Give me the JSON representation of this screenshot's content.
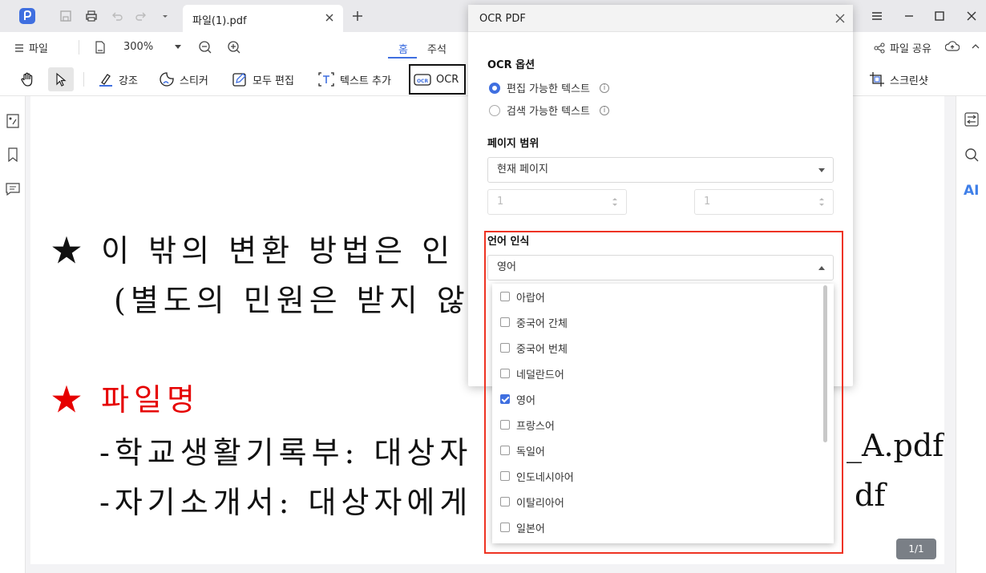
{
  "tab": {
    "title": "파일(1).pdf"
  },
  "menu": {
    "file": "파일",
    "zoom": "300%",
    "home": "홈",
    "annotate": "주석",
    "share": "파일 공유"
  },
  "toolbar": {
    "highlight": "강조",
    "sticker": "스티커",
    "edit_all": "모두 편집",
    "add_text": "텍스트 추가",
    "ocr": "OCR",
    "screenshot": "스크린샷"
  },
  "right_panel": {
    "ai": "AI"
  },
  "document": {
    "line1": "★ 이 밖의 변환 방법은 인",
    "line2": "(별도의 민원은 받지 않",
    "line3": "★ 파일명",
    "line4": "-학교생활기록부: 대상자",
    "line4_tail": "_A.pdf",
    "line5": "-자기소개서: 대상자에게",
    "line5_tail": "df",
    "page_indicator": "1/1"
  },
  "dialog": {
    "title": "OCR PDF",
    "ocr_options_label": "OCR 옵션",
    "radio_editable": "편집 가능한 텍스트",
    "radio_searchable": "검색 가능한 텍스트",
    "page_range_label": "페이지 범위",
    "page_range_value": "현재 페이지",
    "range_from": "1",
    "range_to": "1",
    "language_label": "언어 인식",
    "language_value": "영어",
    "languages": [
      {
        "label": "아랍어",
        "checked": false
      },
      {
        "label": "중국어 간체",
        "checked": false
      },
      {
        "label": "중국어 번체",
        "checked": false
      },
      {
        "label": "네덜란드어",
        "checked": false
      },
      {
        "label": "영어",
        "checked": true
      },
      {
        "label": "프랑스어",
        "checked": false
      },
      {
        "label": "독일어",
        "checked": false
      },
      {
        "label": "인도네시아어",
        "checked": false
      },
      {
        "label": "이탈리아어",
        "checked": false
      },
      {
        "label": "일본어",
        "checked": false
      }
    ]
  },
  "colors": {
    "accent": "#3f6fe0",
    "highlight_box": "#ee3322",
    "doc_red": "#e60000"
  }
}
